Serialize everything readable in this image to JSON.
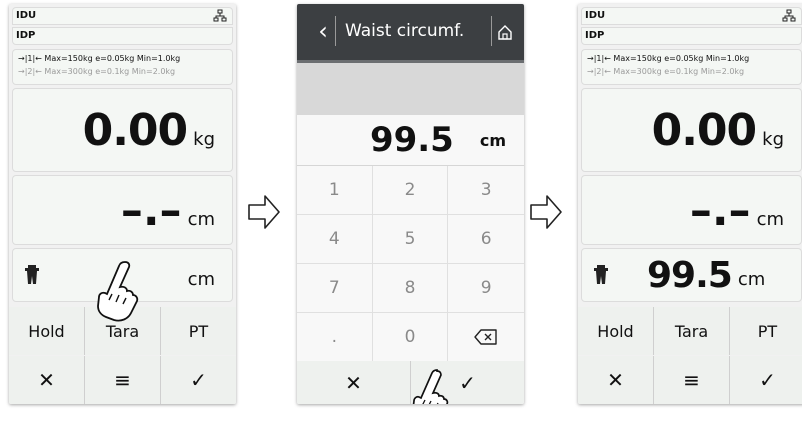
{
  "left_screen": {
    "idu": "IDU",
    "idp": "IDP",
    "range1": "→|1|← Max=150kg e=0.05kg Min=1.0kg",
    "range2": "→|2|← Max=300kg e=0.1kg Min=2.0kg",
    "weight_value": "0.00",
    "weight_unit": "kg",
    "height_value": "–.–",
    "height_unit": "cm",
    "waist_unit": "cm",
    "hold_label": "Hold",
    "tara_label": "Tara",
    "pt_label": "PT"
  },
  "middle_screen": {
    "title": "Waist circumf.",
    "display_value": "99.5",
    "display_unit": "cm",
    "keys": [
      "1",
      "2",
      "3",
      "4",
      "5",
      "6",
      "7",
      "8",
      "9",
      ".",
      "0"
    ]
  },
  "right_screen": {
    "idu": "IDU",
    "idp": "IDP",
    "range1": "→|1|← Max=150kg e=0.05kg Min=1.0kg",
    "range2": "→|2|← Max=300kg e=0.1kg Min=2.0kg",
    "weight_value": "0.00",
    "weight_unit": "kg",
    "height_value": "–.–",
    "height_unit": "cm",
    "waist_value": "99.5",
    "waist_unit": "cm",
    "hold_label": "Hold",
    "tara_label": "Tara",
    "pt_label": "PT"
  },
  "icons": {
    "network": "network-icon",
    "waist": "waist-icon",
    "cancel": "close-icon",
    "menu": "menu-icon",
    "confirm": "check-icon",
    "backspace": "backspace-icon",
    "home": "home-icon",
    "back": "chevron-left-icon",
    "pointer": "hand-pointer-icon",
    "flow": "arrow-right-icon"
  }
}
